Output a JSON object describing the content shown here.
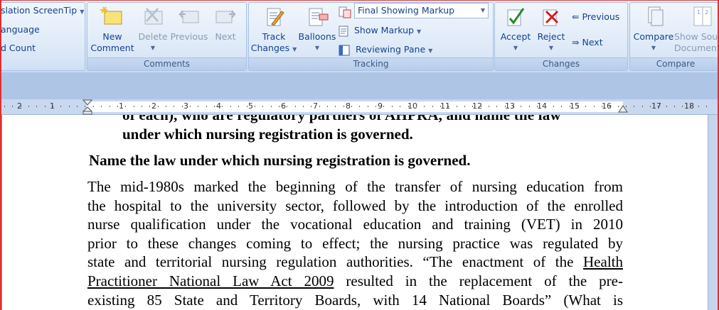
{
  "ribbon": {
    "partial_left": {
      "translation_screentip": "slation ScreenTip",
      "language": "anguage",
      "word_count": "d Count"
    },
    "comments": {
      "label": "Comments",
      "new_comment_line1": "New",
      "new_comment_line2": "Comment",
      "delete": "Delete",
      "previous": "Previous",
      "next": "Next"
    },
    "tracking": {
      "label": "Tracking",
      "track_changes_line1": "Track",
      "track_changes_line2": "Changes",
      "balloons": "Balloons",
      "markup_mode": "Final Showing Markup",
      "show_markup": "Show Markup",
      "reviewing_pane": "Reviewing Pane"
    },
    "changes": {
      "label": "Changes",
      "accept": "Accept",
      "reject": "Reject",
      "previous": "Previous",
      "next": "Next"
    },
    "compare": {
      "label": "Compare",
      "compare": "Compare",
      "show_source_line1": "Show Sour",
      "show_source_line2": "Document"
    }
  },
  "ruler": {
    "left_numbers": [
      "2",
      "1"
    ],
    "right_numbers": [
      "1",
      "2",
      "3",
      "4",
      "5",
      "6",
      "7",
      "8",
      "9",
      "10",
      "11",
      "12",
      "13",
      "14",
      "15",
      "16",
      "17",
      "18"
    ]
  },
  "document": {
    "cut_line": "of each), who are regulatory partners of AHPRA, and name the law",
    "heading_cont": "under which nursing registration is governed.",
    "heading2": "Name the law under which nursing registration is governed.",
    "para_lines": [
      "The mid-1980s marked the beginning of the transfer of nursing education from",
      "the hospital to the university sector, followed by the introduction of the enrolled",
      "nurse qualification under the vocational education and training (VET) in 2010",
      "prior to these changes coming to effect; the nursing practice was regulated by",
      "state and territorial nursing regulation authorities. “The enactment of the"
    ],
    "link_part1": "Health",
    "link_part2": "Practitioner National Law Act 2009",
    "after_link": " resulted in the replacement of the pre-",
    "last_line": "existing 85 State and Territory Boards, with 14 National Boards” (What is"
  },
  "colors": {
    "ribbon_text": "#15428b",
    "disabled_text": "#8a9bb3",
    "ribbon_bg": "#d3e2f7",
    "frame_bg": "#aec5e6"
  }
}
